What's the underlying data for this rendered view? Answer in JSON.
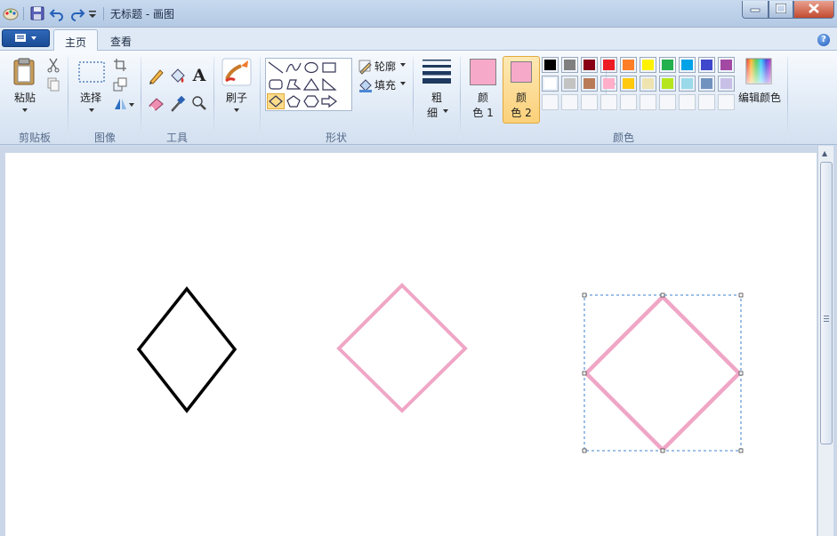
{
  "title_bar": {
    "title": "无标题 - 画图",
    "quick_access": [
      "paint-app-icon",
      "save-icon",
      "undo-icon",
      "redo-icon",
      "customize-dropdown-icon"
    ],
    "controls": [
      "minimize-icon",
      "maximize-icon",
      "close-icon"
    ]
  },
  "tabs": [
    {
      "label": "主页",
      "active": true
    },
    {
      "label": "查看",
      "active": false
    }
  ],
  "ribbon": {
    "clipboard": {
      "paste_label": "粘贴",
      "group_label": "剪贴板",
      "icons": [
        "cut-icon",
        "copy-icon"
      ]
    },
    "image": {
      "select_label": "选择",
      "group_label": "图像",
      "icons": [
        "crop-icon",
        "resize-icon",
        "rotate-icon"
      ]
    },
    "tools": {
      "group_label": "工具",
      "icons": [
        "pencil-icon",
        "fill-bucket-icon",
        "text-icon",
        "eraser-icon",
        "color-picker-icon",
        "magnifier-icon"
      ],
      "text_glyph": "A"
    },
    "brushes": {
      "label": "刷子"
    },
    "shapes": {
      "group_label": "形状",
      "outline_label": "轮廓",
      "fill_label": "填充",
      "selected_shape": "diamond"
    },
    "size": {
      "label_top": "粗",
      "label_bottom": "细"
    },
    "colors": {
      "group_label": "颜色",
      "color1_top": "颜",
      "color1_bottom": "色 1",
      "color2_top": "颜",
      "color2_bottom": "色 2",
      "color1_value": "#f7a9c9",
      "color2_value": "#f7a9c9",
      "edit_label": "编辑颜色",
      "palette_row1": [
        "#000000",
        "#7f7f7f",
        "#880015",
        "#ed1c24",
        "#ff7f27",
        "#fff200",
        "#22b14c",
        "#00a2e8",
        "#3f48cc",
        "#a349a4"
      ],
      "palette_row2": [
        "#ffffff",
        "#c3c3c3",
        "#b97a57",
        "#ffaec9",
        "#ffc90e",
        "#efe4b0",
        "#b5e61d",
        "#99d9ea",
        "#7092be",
        "#c8bfe7"
      ]
    }
  },
  "canvas": {
    "shapes": [
      {
        "name": "black-diamond",
        "color": "#000000"
      },
      {
        "name": "pink-diamond",
        "color": "#f0a6c6"
      },
      {
        "name": "selected-pink-diamond",
        "color": "#f0a6c6",
        "selected": true
      }
    ]
  }
}
